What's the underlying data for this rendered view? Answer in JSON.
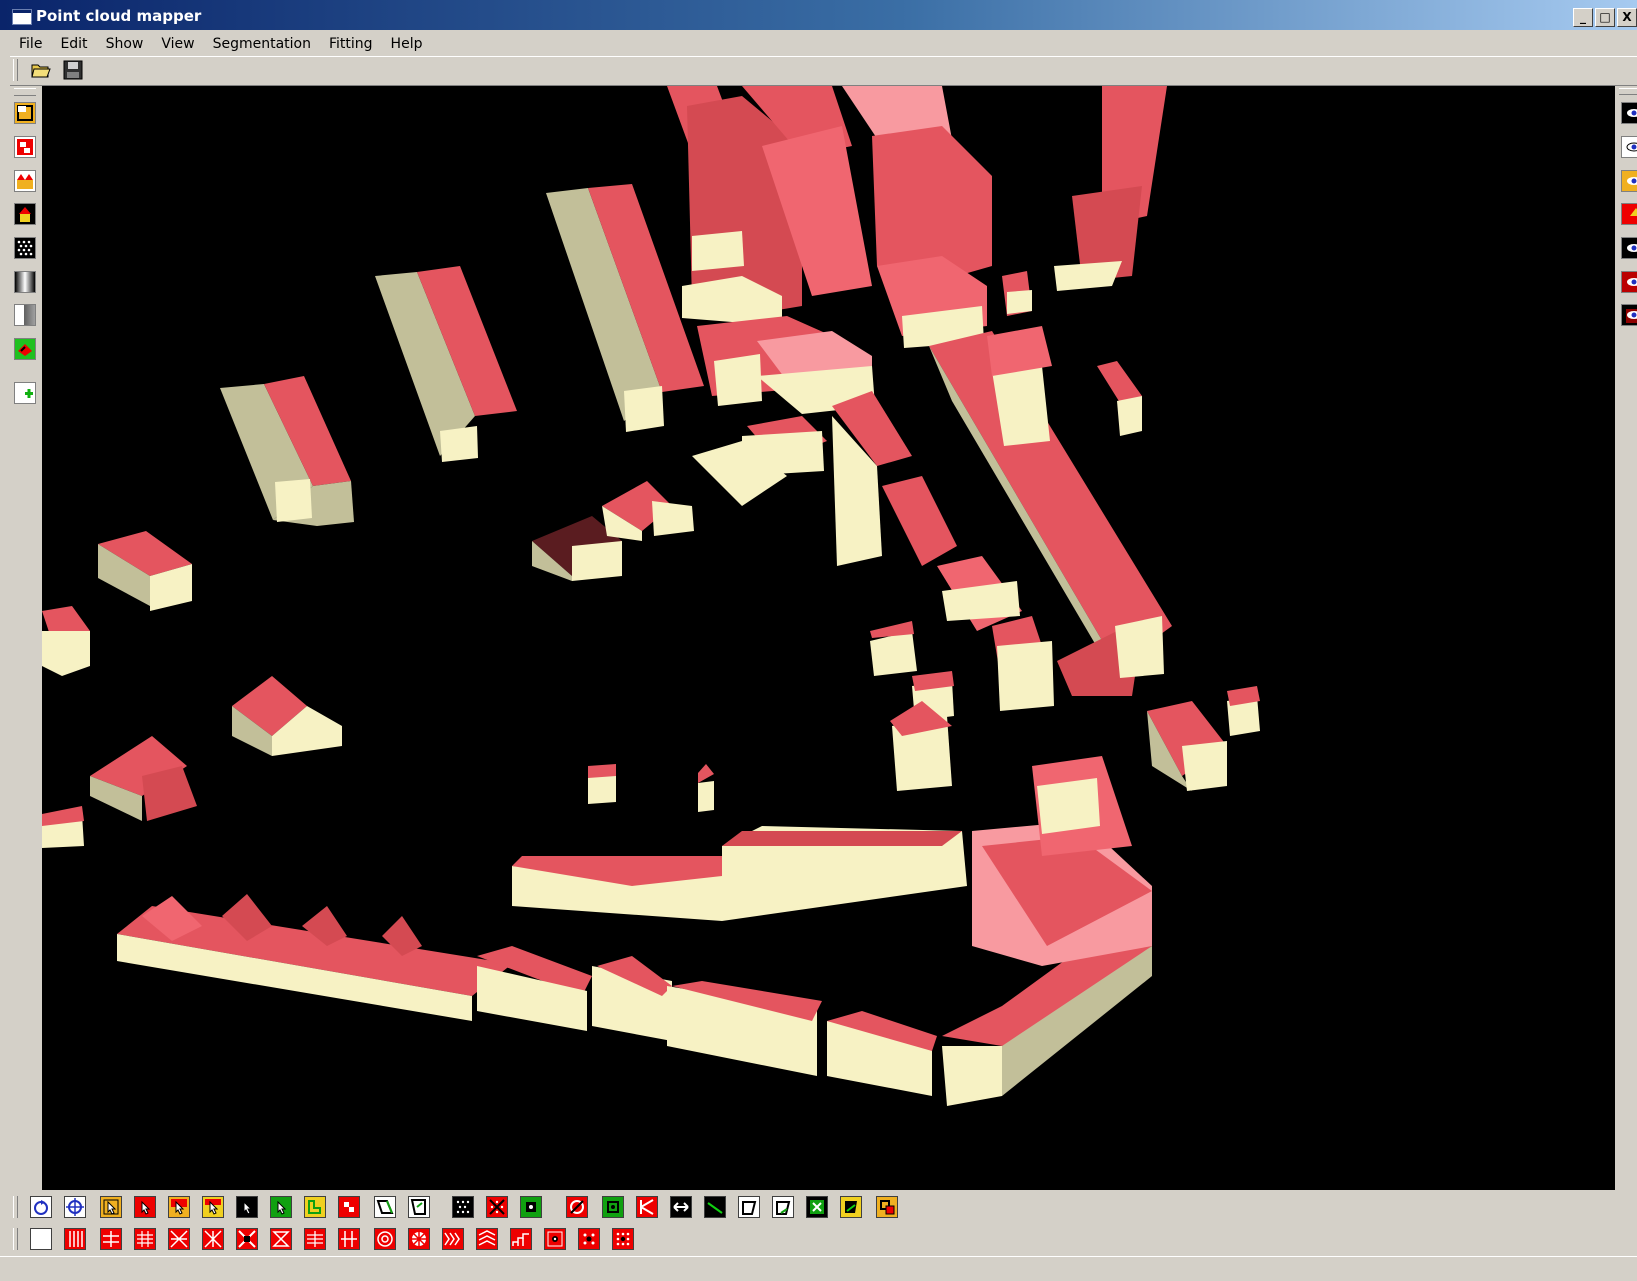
{
  "window": {
    "title": "Point cloud mapper",
    "controls": [
      "_",
      "□",
      "X"
    ]
  },
  "menu": {
    "items": [
      "File",
      "Edit",
      "Show",
      "View",
      "Segmentation",
      "Fitting",
      "Help"
    ]
  },
  "toolbar": {
    "icons": [
      "open-folder-icon",
      "save-disk-icon"
    ]
  },
  "left_toolbar": {
    "icons": [
      "roof-outline-icon",
      "red-segments-icon",
      "building-view-icon",
      "house-height-icon",
      "point-cloud-icon",
      "gradient-gray-icon",
      "gray-square-icon",
      "green-map-icon",
      "add-icon"
    ]
  },
  "right_toolbar": {
    "icons": [
      "eye-icon",
      "eye-outline-icon",
      "eye-orange-icon",
      "eye-red-icon",
      "eye-points-icon",
      "eye-dark-red-icon",
      "eye-black-icon"
    ]
  },
  "bottom_toolbar_1": {
    "icons": [
      "rotate-icon",
      "crosshair-icon",
      "select-orange-icon",
      "select-red-icon",
      "select-multi-icon",
      "select-yellow-icon",
      "select-black-icon",
      "select-green-icon",
      "fit-green-icon",
      "fit-red-icon",
      "polygon-icon",
      "quad-icon",
      "points-icon",
      "cross-points-icon",
      "green-square-icon",
      "red-diagonal-icon",
      "green-target-icon",
      "split-icon",
      "arrows-icon",
      "line-icon",
      "shape-icon",
      "shape2-icon",
      "green-grid-icon",
      "yellow-shape-icon",
      "orange-shape-icon"
    ]
  },
  "bottom_toolbar_2": {
    "icons": [
      "empty-square-icon",
      "red-vertical-lines-icon",
      "red-grid-icon",
      "red-columns-icon",
      "red-cross-icon",
      "red-hatch-icon",
      "red-x-icon",
      "red-hourglass-icon",
      "red-horizontal-icon",
      "red-bars-icon",
      "red-circle-icon",
      "red-wheel-icon",
      "red-stripes-icon",
      "red-wave-icon",
      "red-stairs-icon",
      "red-dots-icon",
      "red-dots2-icon",
      "red-dots3-icon"
    ]
  },
  "colors": {
    "roof": "#e4555f",
    "roof_light": "#f89aa0",
    "wall_front": "#f7f2c4",
    "wall_side": "#c2bf99",
    "background": "#000000"
  }
}
